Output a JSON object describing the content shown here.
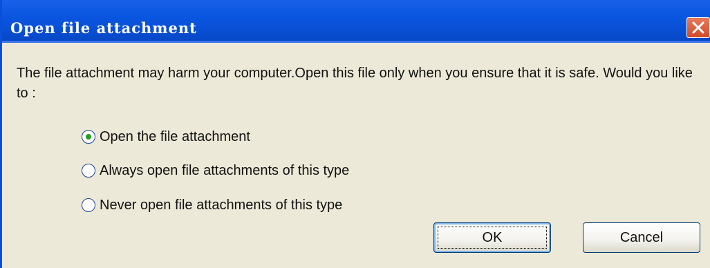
{
  "dialog": {
    "title": "Open file attachment",
    "close_icon": "close-x-icon",
    "message": "The file attachment may harm your computer.Open this file only when you ensure that it is safe. Would you like to :",
    "options": [
      {
        "label": "Open the file attachment",
        "selected": true
      },
      {
        "label": "Always open file attachments of this type",
        "selected": false
      },
      {
        "label": "Never open file attachments of this type",
        "selected": false
      }
    ],
    "ok_label": "OK",
    "cancel_label": "Cancel"
  },
  "colors": {
    "titlebar": "#0a56e0",
    "window_bg": "#ece9d8",
    "close_button": "#d44a2a",
    "radio_dot": "#21a121"
  }
}
